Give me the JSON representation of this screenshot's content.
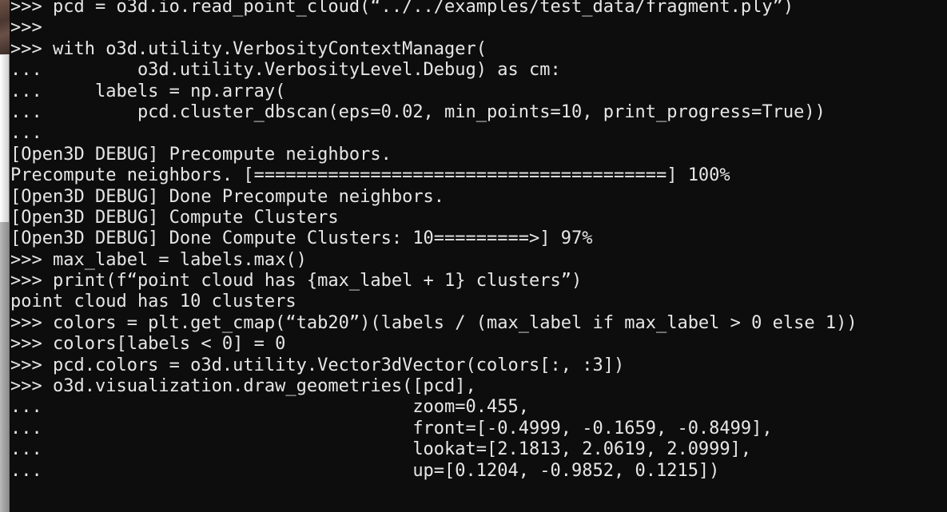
{
  "terminal": {
    "type": "python-repl-console",
    "background_color": "#0d0d0d",
    "text_color": "#e6e6e6",
    "font": "monospace",
    "prompt_primary": ">>>",
    "prompt_continuation": "...",
    "scrollbar": {
      "position": "left",
      "thumb_color": "#e8e8e8",
      "track_color": "#a2a2a2"
    },
    "lines": [
      ">>> pcd = o3d.io.read_point_cloud(“../../examples/test_data/fragment.ply”)",
      ">>>",
      ">>> with o3d.utility.VerbosityContextManager(",
      "...         o3d.utility.VerbosityLevel.Debug) as cm:",
      "...     labels = np.array(",
      "...         pcd.cluster_dbscan(eps=0.02, min_points=10, print_progress=True))",
      "...",
      "[Open3D DEBUG] Precompute neighbors.",
      "Precompute neighbors. [=======================================] 100%",
      "[Open3D DEBUG] Done Precompute neighbors.",
      "[Open3D DEBUG] Compute Clusters",
      "[Open3D DEBUG] Done Compute Clusters: 10=========>] 97%",
      ">>> max_label = labels.max()",
      ">>> print(f“point cloud has {max_label + 1} clusters”)",
      "point cloud has 10 clusters",
      ">>> colors = plt.get_cmap(“tab20”)(labels / (max_label if max_label > 0 else 1))",
      ">>> colors[labels < 0] = 0",
      ">>> pcd.colors = o3d.utility.Vector3dVector(colors[:, :3])",
      ">>> o3d.visualization.draw_geometries([pcd],",
      "...                                   zoom=0.455,",
      "...                                   front=[-0.4999, -0.1659, -0.8499],",
      "...                                   lookat=[2.1813, 2.0619, 2.0999],",
      "...                                   up=[0.1204, -0.9852, 0.1215])"
    ]
  }
}
